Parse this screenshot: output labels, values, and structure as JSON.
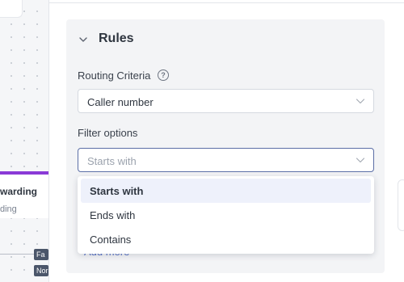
{
  "canvas": {
    "node": {
      "title": "warding",
      "subtitle": "ding"
    },
    "tags": [
      "Fa",
      "Nor"
    ]
  },
  "panel": {
    "section_title": "Rules",
    "routing": {
      "label": "Routing Criteria",
      "help": "?",
      "value": "Caller number"
    },
    "filter": {
      "label": "Filter options",
      "placeholder": "Starts with",
      "options": [
        "Starts with",
        "Ends with",
        "Contains"
      ]
    },
    "add_more": "Add more"
  },
  "colors": {
    "accent": "#8a3ad6",
    "focus_border": "#5b6ea6",
    "link": "#5a74c9"
  }
}
